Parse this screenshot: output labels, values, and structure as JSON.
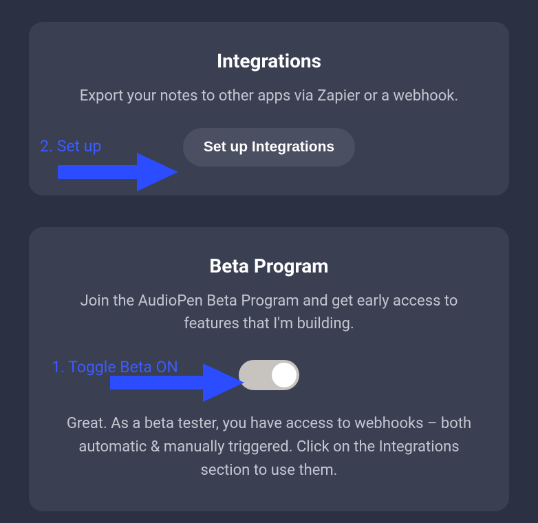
{
  "integrations": {
    "title": "Integrations",
    "description": "Export your notes to other apps via Zapier or a webhook.",
    "button_label": "Set up Integrations"
  },
  "beta": {
    "title": "Beta Program",
    "description": "Join the AudioPen Beta Program and get early access to features that I'm building.",
    "toggle_state": "on",
    "message": "Great. As a beta tester, you have access to webhooks – both automatic & manually triggered. Click on the Integrations section to use them."
  },
  "annotations": {
    "step1": "1. Toggle Beta ON",
    "step2": "2. Set up"
  },
  "colors": {
    "annotation": "#3b5cff",
    "background": "#2b3043",
    "card": "#3a3f52"
  }
}
